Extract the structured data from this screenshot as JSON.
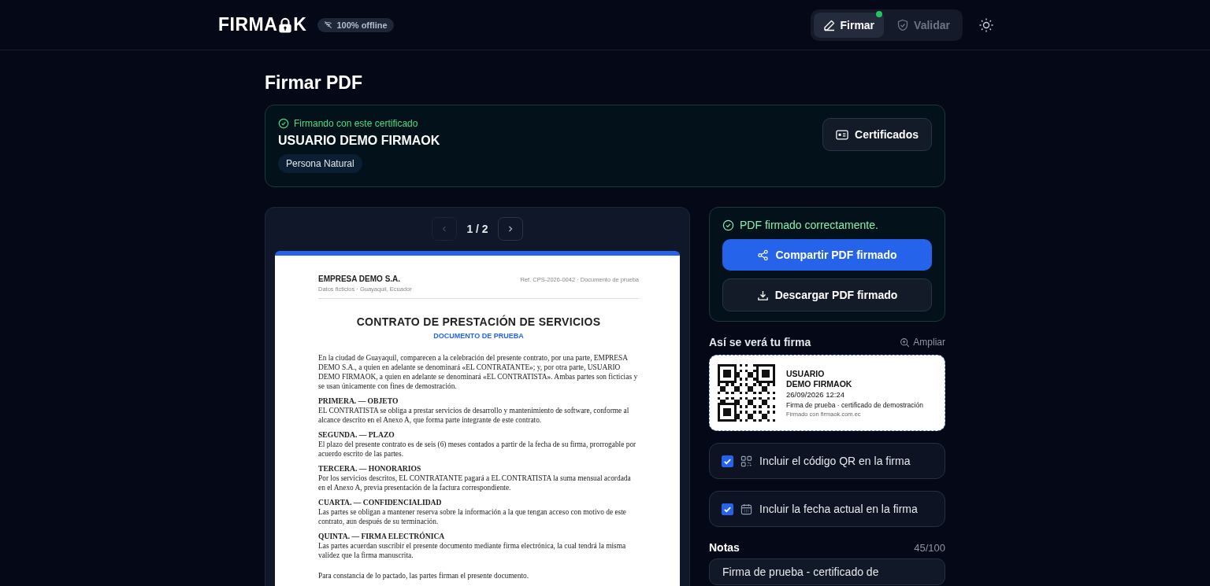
{
  "header": {
    "logo": {
      "left": "FIRMA",
      "right": "K"
    },
    "badge": "100% offline",
    "tabs": [
      {
        "label": "Firmar",
        "selected": true,
        "notify": true
      },
      {
        "label": "Validar",
        "selected": false,
        "notify": false
      }
    ]
  },
  "page_title": "Firmar PDF",
  "certificate": {
    "status": "Firmando con este certificado",
    "name": "USUARIO DEMO FIRMAOK",
    "tag": "Persona Natural",
    "button": "Certificados"
  },
  "viewer": {
    "page_indicator": "1 / 2",
    "prev_disabled": true,
    "next_disabled": false,
    "document": {
      "company": "EMPRESA DEMO S.A.",
      "company_note": "Datos ficticios · Guayaquil, Ecuador",
      "reference": "Ref. CPS-2026-0042 · Documento de prueba",
      "title": "CONTRATO DE PRESTACIÓN DE SERVICIOS",
      "subtitle": "DOCUMENTO DE PRUEBA",
      "intro": "En la ciudad de Guayaquil, comparecen a la celebración del presente contrato, por una parte, EMPRESA DEMO S.A., a quien en adelante se denominará «EL CONTRATANTE»; y, por otra parte, USUARIO DEMO FIRMAOK, a quien en adelante se denominará «EL CONTRATISTA». Ambas partes son ficticias y se usan únicamente con fines de demostración.",
      "clauses": [
        {
          "heading": "PRIMERA. — OBJETO",
          "body": "EL CONTRATISTA se obliga a prestar servicios de desarrollo y mantenimiento de software, conforme al alcance descrito en el Anexo A, que forma parte integrante de este contrato."
        },
        {
          "heading": "SEGUNDA. — PLAZO",
          "body": "El plazo del presente contrato es de seis (6) meses contados a partir de la fecha de su firma, prorrogable por acuerdo escrito de las partes."
        },
        {
          "heading": "TERCERA. — HONORARIOS",
          "body": "Por los servicios descritos, EL CONTRATANTE pagará a EL CONTRATISTA la suma mensual acordada en el Anexo A, previa presentación de la factura correspondiente."
        },
        {
          "heading": "CUARTA. — CONFIDENCIALIDAD",
          "body": "Las partes se obligan a mantener reserva sobre la información a la que tengan acceso con motivo de este contrato, aun después de su terminación."
        },
        {
          "heading": "QUINTA. — FIRMA ELECTRÓNICA",
          "body": "Las partes acuerdan suscribir el presente documento mediante firma electrónica, la cual tendrá la misma validez que la firma manuscrita."
        }
      ],
      "closing": "Para constancia de lo pactado, las partes firman el presente documento."
    }
  },
  "result": {
    "message": "PDF firmado correctamente.",
    "share_button": "Compartir PDF firmado",
    "download_button": "Descargar PDF firmado"
  },
  "preview": {
    "label": "Así se verá tu firma",
    "zoom_link": "Ampliar",
    "name_line_1": "USUARIO",
    "name_line_2": "DEMO FIRMAOK",
    "date": "26/09/2026 12:24",
    "reason": "Firma de prueba · certificado de demostración",
    "footer": "Firmado con firmaok.com.ec"
  },
  "options": [
    {
      "kind": "qr",
      "label": "Incluir el código QR en la firma",
      "checked": true
    },
    {
      "kind": "date",
      "label": "Incluir la fecha actual en la firma",
      "checked": true
    }
  ],
  "notes": {
    "label": "Notas",
    "counter": "45/100",
    "value": "Firma de prueba - certificado de"
  }
}
